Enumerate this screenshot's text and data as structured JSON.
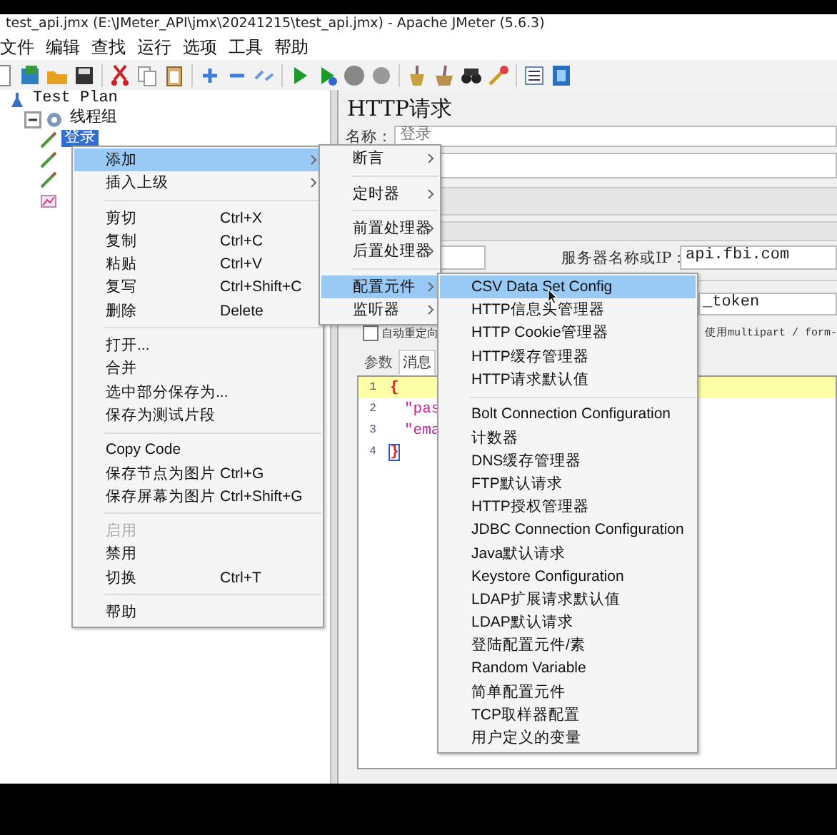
{
  "window": {
    "title": "test_api.jmx (E:\\JMeter_API\\jmx\\20241215\\test_api.jmx) - Apache JMeter (5.6.3)"
  },
  "menu_bar": [
    "文件",
    "编辑",
    "查找",
    "运行",
    "选项",
    "工具",
    "帮助"
  ],
  "tree": [
    {
      "label": "Test Plan",
      "kind": "plan",
      "selected": false,
      "children": [
        {
          "label": "线程组",
          "kind": "thread_group",
          "selected": false,
          "expanded": true,
          "children": [
            {
              "label": "登录",
              "kind": "sampler",
              "selected": true
            },
            {
              "kind": "sampler"
            },
            {
              "kind": "sampler"
            },
            {
              "kind": "listener"
            }
          ]
        }
      ]
    }
  ],
  "http_request": {
    "title": "HTTP请求",
    "name_label": "名称：",
    "name_value": "登录",
    "server_label": "服务器名称或IP：",
    "server_value": "api.fbi.com",
    "path_value": "_token",
    "redirect": {
      "label": "自动重定向",
      "checked": false
    },
    "multipart_label": "使用multipart / form-",
    "tabs": [
      {
        "label": "参数",
        "selected": false
      },
      {
        "label": "消息",
        "selected": true
      }
    ],
    "editor_lines": [
      {
        "number": "1",
        "text": "{",
        "kind": "brace",
        "current": true,
        "matched": false
      },
      {
        "number": "2",
        "text": "\"pas",
        "kind": "string",
        "current": false,
        "matched": false
      },
      {
        "number": "3",
        "text": "\"ema",
        "kind": "string",
        "current": false,
        "matched": false
      },
      {
        "number": "4",
        "text": "}",
        "kind": "brace",
        "current": false,
        "matched": true
      }
    ]
  },
  "context_menu": {
    "items": [
      {
        "kind": "item",
        "label": "添加",
        "submenu": true,
        "selected": true,
        "disabled": false
      },
      {
        "kind": "item",
        "label": "插入上级",
        "submenu": true,
        "selected": false,
        "disabled": false
      },
      {
        "kind": "separator"
      },
      {
        "kind": "item",
        "label": "剪切",
        "shortcut": "Ctrl+X",
        "selected": false,
        "disabled": false
      },
      {
        "kind": "item",
        "label": "复制",
        "shortcut": "Ctrl+C",
        "selected": false,
        "disabled": false
      },
      {
        "kind": "item",
        "label": "粘贴",
        "shortcut": "Ctrl+V",
        "selected": false,
        "disabled": false
      },
      {
        "kind": "item",
        "label": "复写",
        "shortcut": "Ctrl+Shift+C",
        "selected": false,
        "disabled": false
      },
      {
        "kind": "item",
        "label": "删除",
        "shortcut": "Delete",
        "selected": false,
        "disabled": false
      },
      {
        "kind": "separator"
      },
      {
        "kind": "item",
        "label": "打开...",
        "selected": false,
        "disabled": false
      },
      {
        "kind": "item",
        "label": "合并",
        "selected": false,
        "disabled": false
      },
      {
        "kind": "item",
        "label": "选中部分保存为...",
        "selected": false,
        "disabled": false
      },
      {
        "kind": "item",
        "label": "保存为测试片段",
        "selected": false,
        "disabled": false
      },
      {
        "kind": "separator"
      },
      {
        "kind": "item",
        "label": "Copy Code",
        "selected": false,
        "disabled": false
      },
      {
        "kind": "item",
        "label": "保存节点为图片",
        "shortcut": "Ctrl+G",
        "selected": false,
        "disabled": false
      },
      {
        "kind": "item",
        "label": "保存屏幕为图片",
        "shortcut": "Ctrl+Shift+G",
        "selected": false,
        "disabled": false
      },
      {
        "kind": "separator"
      },
      {
        "kind": "item",
        "label": "启用",
        "selected": false,
        "disabled": true
      },
      {
        "kind": "item",
        "label": "禁用",
        "selected": false,
        "disabled": false
      },
      {
        "kind": "item",
        "label": "切换",
        "shortcut": "Ctrl+T",
        "selected": false,
        "disabled": false
      },
      {
        "kind": "separator"
      },
      {
        "kind": "item",
        "label": "帮助",
        "selected": false,
        "disabled": false
      }
    ]
  },
  "add_submenu": {
    "items": [
      {
        "kind": "item",
        "label": "断言",
        "submenu": true,
        "selected": false
      },
      {
        "kind": "separator"
      },
      {
        "kind": "item",
        "label": "定时器",
        "submenu": true,
        "selected": false
      },
      {
        "kind": "separator"
      },
      {
        "kind": "item",
        "label": "前置处理器",
        "submenu": true,
        "selected": false
      },
      {
        "kind": "item",
        "label": "后置处理器",
        "submenu": true,
        "selected": false
      },
      {
        "kind": "separator"
      },
      {
        "kind": "item",
        "label": "配置元件",
        "submenu": true,
        "selected": true
      },
      {
        "kind": "item",
        "label": "监听器",
        "submenu": true,
        "selected": false
      }
    ]
  },
  "config_submenu": {
    "items": [
      {
        "kind": "item",
        "label": "CSV Data Set Config",
        "selected": true
      },
      {
        "kind": "item",
        "label": "HTTP信息头管理器",
        "selected": false
      },
      {
        "kind": "item",
        "label": "HTTP Cookie管理器",
        "selected": false
      },
      {
        "kind": "item",
        "label": "HTTP缓存管理器",
        "selected": false
      },
      {
        "kind": "item",
        "label": "HTTP请求默认值",
        "selected": false
      },
      {
        "kind": "separator"
      },
      {
        "kind": "item",
        "label": "Bolt Connection Configuration",
        "selected": false
      },
      {
        "kind": "item",
        "label": "计数器",
        "selected": false
      },
      {
        "kind": "item",
        "label": "DNS缓存管理器",
        "selected": false
      },
      {
        "kind": "item",
        "label": "FTP默认请求",
        "selected": false
      },
      {
        "kind": "item",
        "label": "HTTP授权管理器",
        "selected": false
      },
      {
        "kind": "item",
        "label": "JDBC Connection Configuration",
        "selected": false
      },
      {
        "kind": "item",
        "label": "Java默认请求",
        "selected": false
      },
      {
        "kind": "item",
        "label": "Keystore Configuration",
        "selected": false
      },
      {
        "kind": "item",
        "label": "LDAP扩展请求默认值",
        "selected": false
      },
      {
        "kind": "item",
        "label": "LDAP默认请求",
        "selected": false
      },
      {
        "kind": "item",
        "label": "登陆配置元件/素",
        "selected": false
      },
      {
        "kind": "item",
        "label": "Random Variable",
        "selected": false
      },
      {
        "kind": "item",
        "label": "简单配置元件",
        "selected": false
      },
      {
        "kind": "item",
        "label": "TCP取样器配置",
        "selected": false
      },
      {
        "kind": "item",
        "label": "用户定义的变量",
        "selected": false
      }
    ]
  }
}
